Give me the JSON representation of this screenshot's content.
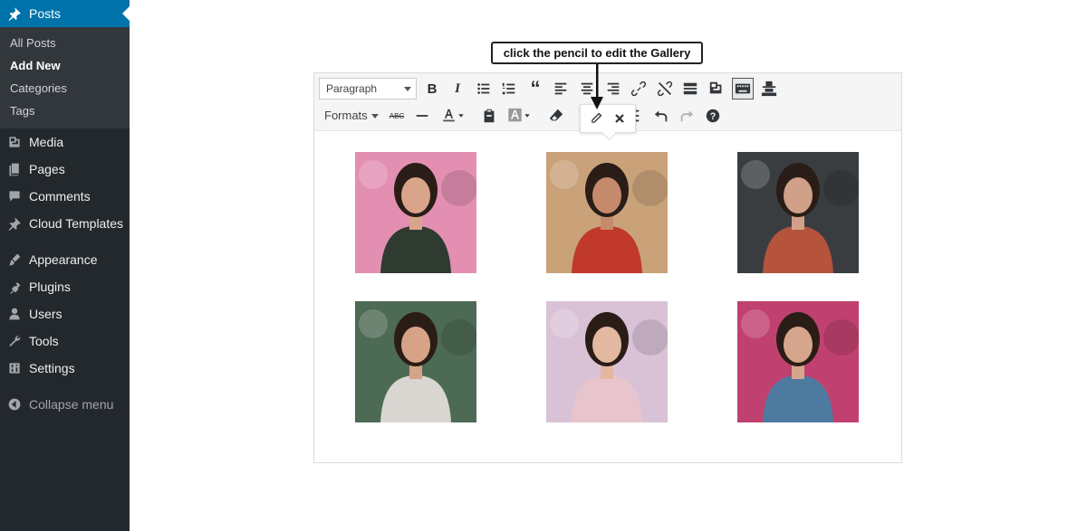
{
  "sidebar": {
    "posts": {
      "label": "Posts",
      "icon": "pushpin-icon"
    },
    "submenu": [
      "All Posts",
      "Add New",
      "Categories",
      "Tags"
    ],
    "items": [
      {
        "label": "Media",
        "icon": "media-icon"
      },
      {
        "label": "Pages",
        "icon": "pages-icon"
      },
      {
        "label": "Comments",
        "icon": "comment-icon"
      },
      {
        "label": "Cloud Templates",
        "icon": "pushpin-icon"
      },
      {
        "label": "Appearance",
        "icon": "brush-icon"
      },
      {
        "label": "Plugins",
        "icon": "plugin-icon"
      },
      {
        "label": "Users",
        "icon": "user-icon"
      },
      {
        "label": "Tools",
        "icon": "wrench-icon"
      },
      {
        "label": "Settings",
        "icon": "settings-icon"
      }
    ],
    "collapse": "Collapse menu"
  },
  "callout": {
    "text": "click the pencil to edit the Gallery"
  },
  "toolbar": {
    "paragraph": "Paragraph",
    "formats": "Formats"
  },
  "gallery": {
    "images": [
      {
        "alt": "woman-flowers-dark-top",
        "bg": "#e28fb2",
        "skin": "#d8a48a",
        "cloth": "#2f3a30"
      },
      {
        "alt": "woman-red-dress",
        "bg": "#c9a27a",
        "skin": "#c58a6c",
        "cloth": "#c0392b"
      },
      {
        "alt": "woman-rust-top",
        "bg": "#3a3d40",
        "skin": "#d1a088",
        "cloth": "#b5533c"
      },
      {
        "alt": "woman-flower-crown",
        "bg": "#4d6a55",
        "skin": "#d6a386",
        "cloth": "#d9d6d2"
      },
      {
        "alt": "woman-pink-blossoms",
        "bg": "#d9c2d6",
        "skin": "#e3b8a0",
        "cloth": "#e8c4cc"
      },
      {
        "alt": "woman-denim-jacket",
        "bg": "#c0416f",
        "skin": "#d6a68c",
        "cloth": "#4f7aa0"
      }
    ]
  },
  "colors": {
    "sidebar_bg": "#23282d",
    "active": "#0073aa"
  }
}
